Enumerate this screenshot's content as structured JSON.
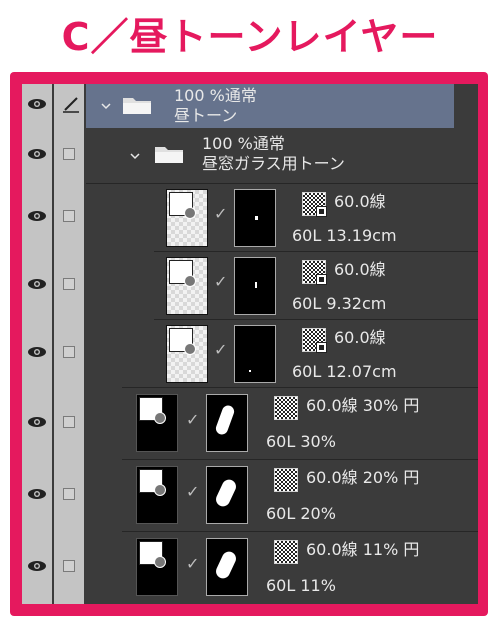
{
  "title": "C／昼トーンレイヤー",
  "colors": {
    "accent": "#e5195e",
    "panel": "#3b3b3b",
    "selected": "#66738d",
    "column": "#c4c4c4"
  },
  "layers": [
    {
      "kind": "folder",
      "blend": "100 %通常",
      "name": "昼トーン",
      "selected": true
    },
    {
      "kind": "folder",
      "blend": "100 %通常",
      "name": "昼窓ガラス用トーン",
      "selected": false
    },
    {
      "kind": "tone",
      "tone_label": "60.0線",
      "info": "60L 13.19cm"
    },
    {
      "kind": "tone",
      "tone_label": "60.0線",
      "info": "60L 9.32cm"
    },
    {
      "kind": "tone",
      "tone_label": "60.0線",
      "info": "60L 12.07cm"
    },
    {
      "kind": "tone",
      "tone_label": "60.0線 30% 円",
      "info": "60L 30%"
    },
    {
      "kind": "tone",
      "tone_label": "60.0線 20% 円",
      "info": "60L 20%"
    },
    {
      "kind": "tone",
      "tone_label": "60.0線 11% 円",
      "info": "60L 11%"
    }
  ]
}
